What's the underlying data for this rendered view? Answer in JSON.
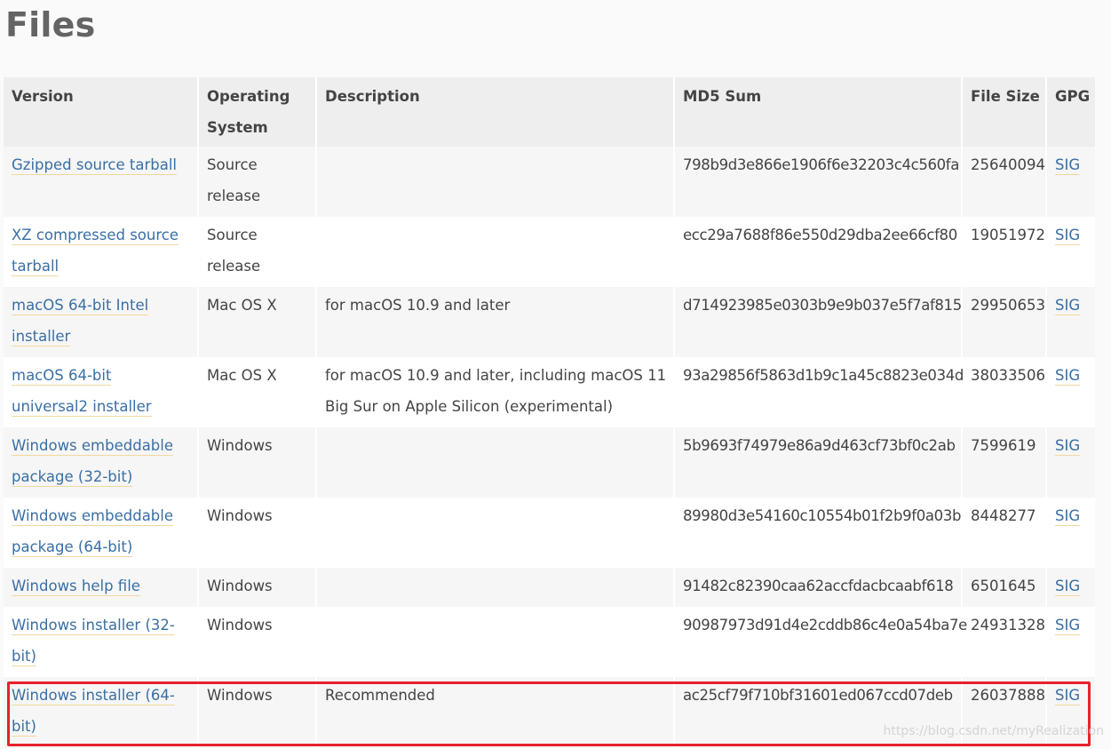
{
  "page": {
    "title": "Files"
  },
  "table": {
    "headers": [
      "Version",
      "Operating System",
      "Description",
      "MD5 Sum",
      "File Size",
      "GPG"
    ],
    "rows": [
      {
        "version": "Gzipped source tarball",
        "os": "Source release",
        "description": "",
        "md5": "798b9d3e866e1906f6e32203c4c560fa",
        "size": "25640094",
        "gpg": "SIG"
      },
      {
        "version": "XZ compressed source tarball",
        "os": "Source release",
        "description": "",
        "md5": "ecc29a7688f86e550d29dba2ee66cf80",
        "size": "19051972",
        "gpg": "SIG"
      },
      {
        "version": "macOS 64-bit Intel installer",
        "os": "Mac OS X",
        "description": "for macOS 10.9 and later",
        "md5": "d714923985e0303b9e9b037e5f7af815",
        "size": "29950653",
        "gpg": "SIG"
      },
      {
        "version": "macOS 64-bit universal2 installer",
        "os": "Mac OS X",
        "description": "for macOS 10.9 and later, including macOS 11 Big Sur on Apple Silicon (experimental)",
        "md5": "93a29856f5863d1b9c1a45c8823e034d",
        "size": "38033506",
        "gpg": "SIG"
      },
      {
        "version": "Windows embeddable package (32-bit)",
        "os": "Windows",
        "description": "",
        "md5": "5b9693f74979e86a9d463cf73bf0c2ab",
        "size": "7599619",
        "gpg": "SIG"
      },
      {
        "version": "Windows embeddable package (64-bit)",
        "os": "Windows",
        "description": "",
        "md5": "89980d3e54160c10554b01f2b9f0a03b",
        "size": "8448277",
        "gpg": "SIG"
      },
      {
        "version": "Windows help file",
        "os": "Windows",
        "description": "",
        "md5": "91482c82390caa62accfdacbcaabf618",
        "size": "6501645",
        "gpg": "SIG"
      },
      {
        "version": "Windows installer (32-bit)",
        "os": "Windows",
        "description": "",
        "md5": "90987973d91d4e2cddb86c4e0a54ba7e",
        "size": "24931328",
        "gpg": "SIG"
      },
      {
        "version": "Windows installer (64-bit)",
        "os": "Windows",
        "description": "Recommended",
        "md5": "ac25cf79f710bf31601ed067ccd07deb",
        "size": "26037888",
        "gpg": "SIG"
      }
    ]
  },
  "watermark": "https://blog.csdn.net/myRealization",
  "colors": {
    "link": "#3a6fa4",
    "highlight": "#e8212b",
    "header_bg": "#eeeeee"
  }
}
